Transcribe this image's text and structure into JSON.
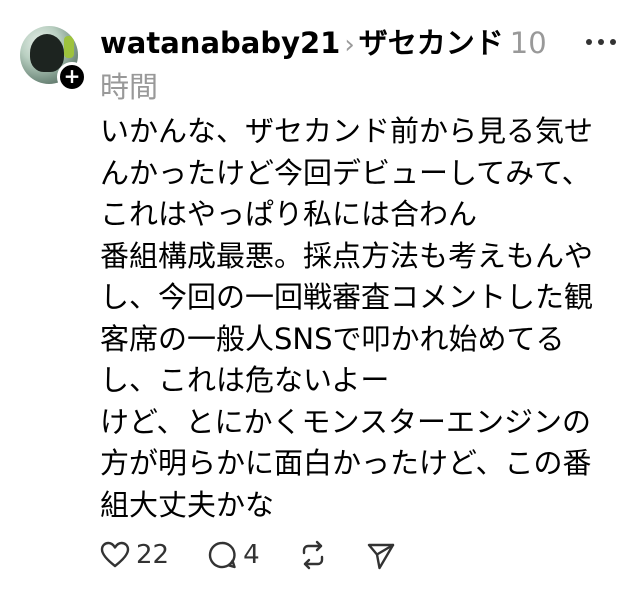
{
  "header": {
    "username": "watanababy21",
    "community": "ザセカンド",
    "time": "10時間"
  },
  "body": {
    "lines": [
      "いかんな、ザセカンド前から見る気せ",
      "んかったけど今回デビューしてみて、",
      "これはやっぱり私には合わん",
      "番組構成最悪。採点方法も考えもんや",
      "し、今回の一回戦審査コメントした観",
      "客席の一般人SNSで叩かれ始めてる",
      "し、これは危ないよー",
      "けど、とにかくモンスターエンジンの",
      "方が明らかに面白かったけど、この番",
      "組大丈夫かな"
    ]
  },
  "actions": {
    "like_count": "22",
    "comment_count": "4"
  },
  "icons": {
    "avatar": "avatar",
    "follow": "plus-icon",
    "more": "more-dots-icon",
    "like": "heart-icon",
    "comment": "comment-icon",
    "repost": "repost-icon",
    "share": "send-icon"
  }
}
